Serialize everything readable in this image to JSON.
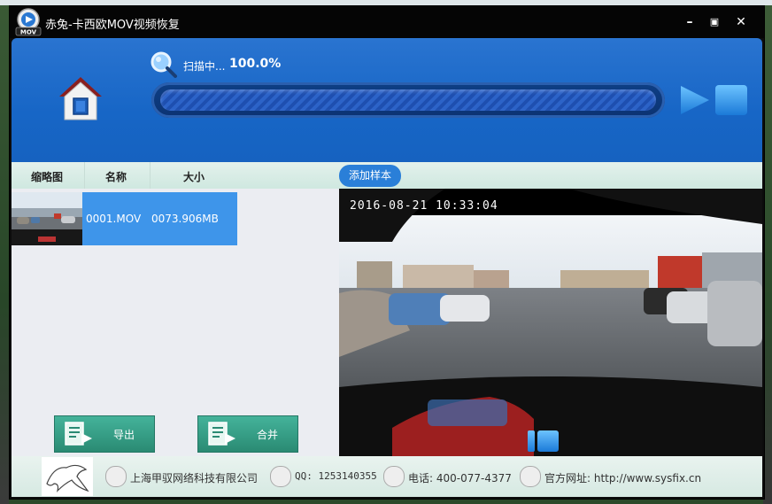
{
  "app": {
    "logo_text": "MOV",
    "title": "赤兔-卡西欧MOV视频恢复",
    "minimize": "–",
    "maximize": "▣",
    "close": "✕"
  },
  "scan": {
    "status": "扫描中...",
    "percent": "100.0%",
    "progress_fraction": 1.0
  },
  "columns": {
    "thumb": "缩略图",
    "name": "名称",
    "size": "大小"
  },
  "add_sample_label": "添加样本",
  "files": [
    {
      "name": "0001.MOV",
      "size": "0073.906MB"
    }
  ],
  "actions": {
    "export_label": "导出",
    "merge_label": "合并"
  },
  "preview": {
    "timestamp": "2016-08-21 10:33:04"
  },
  "footer": {
    "company": "上海甲驭网络科技有限公司",
    "qq": "QQ: 1253140355",
    "phone": "电话: 400-077-4377",
    "website": "官方网址: http://www.sysfix.cn"
  },
  "colors": {
    "header_blue": "#1766c6",
    "selected_row": "#3e95ea",
    "button_green": "#2a8a73"
  }
}
